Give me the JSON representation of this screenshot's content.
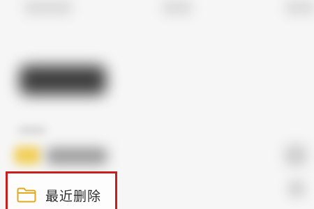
{
  "folder_list": {
    "highlighted_item": {
      "label": "最近删除",
      "icon": "folder-icon"
    }
  },
  "colors": {
    "highlight_border": "#c81e1e",
    "folder_accent": "#e0a91e",
    "background": "#f6f6f6"
  }
}
